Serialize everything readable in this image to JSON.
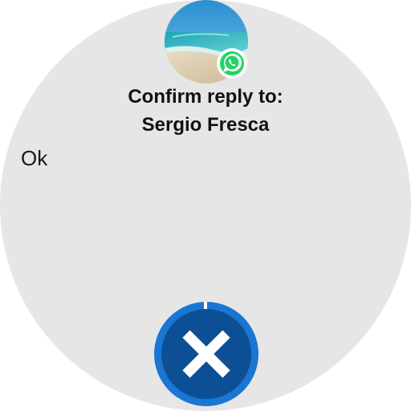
{
  "app": {
    "name": "WhatsApp",
    "icon": "whatsapp-icon"
  },
  "header": {
    "avatar": "contact-avatar-beach-photo",
    "title_line1": "Confirm reply to:",
    "title_line2": "Sergio Fresca"
  },
  "reply": {
    "message": "Ok"
  },
  "actions": {
    "cancel": {
      "icon": "close-icon",
      "accent": "#1976d2",
      "progress": 0.02
    }
  },
  "colors": {
    "background": "#e6e6e6",
    "accent": "#1976d2",
    "whatsapp": "#25d366"
  }
}
